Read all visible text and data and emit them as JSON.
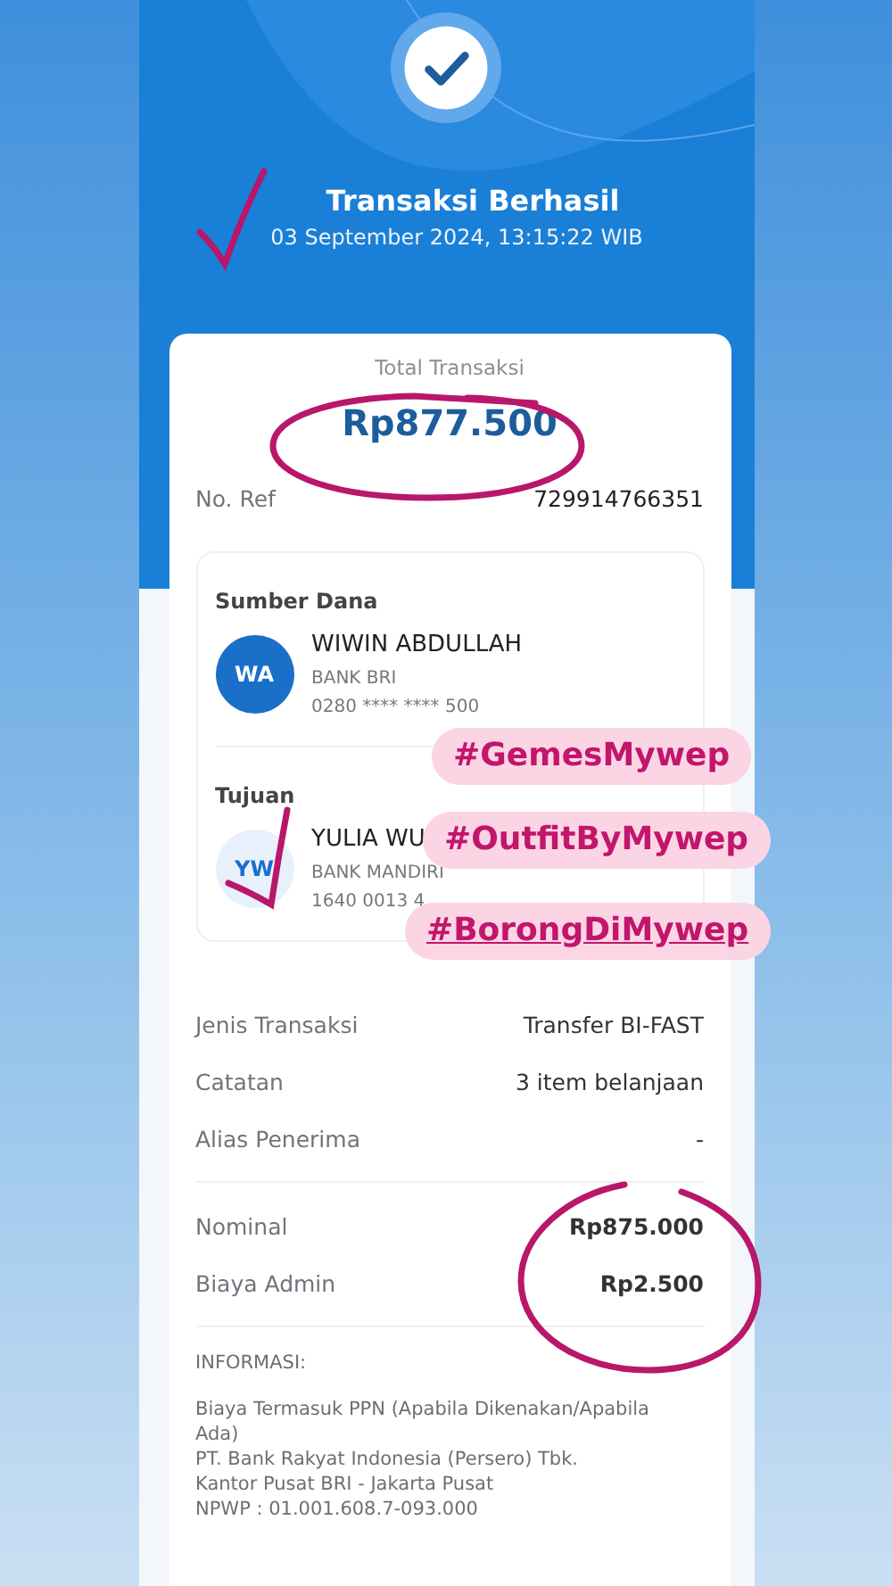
{
  "header": {
    "title": "Transaksi Berhasil",
    "datetime": "03 September 2024, 13:15:22 WIB"
  },
  "summary": {
    "total_label": "Total Transaksi",
    "total_amount": "Rp877.500",
    "ref_label": "No. Ref",
    "ref_value": "729914766351"
  },
  "parties": [
    {
      "heading": "Sumber Dana",
      "initials": "WA",
      "name": "WIWIN ABDULLAH",
      "bank": "BANK BRI",
      "account": "0280 **** **** 500",
      "color": "#1a6fc9"
    },
    {
      "heading": "Tujuan",
      "initials": "YW",
      "name": "YULIA WU",
      "bank": "BANK MANDIRI",
      "account": "1640 0013 4",
      "color": "#e8f1fb"
    }
  ],
  "details": [
    {
      "label": "Jenis Transaksi",
      "value": "Transfer BI-FAST"
    },
    {
      "label": "Catatan",
      "value": "3 item belanjaan"
    },
    {
      "label": "Alias Penerima",
      "value": "-"
    }
  ],
  "amounts": [
    {
      "label": "Nominal",
      "value": "Rp875.000"
    },
    {
      "label": "Biaya Admin",
      "value": "Rp2.500"
    }
  ],
  "info": {
    "heading": "INFORMASI:",
    "text": "Biaya Termasuk PPN (Apabila Dikenakan/Apabila Ada)\nPT. Bank Rakyat Indonesia (Persero) Tbk.\nKantor Pusat BRI - Jakarta Pusat\nNPWP : 01.001.608.7-093.000"
  },
  "stickers": [
    {
      "text": "#GemesMywep",
      "underlined": false
    },
    {
      "text": "#OutfitByMywep",
      "underlined": false
    },
    {
      "text": "#BorongDiMywep",
      "underlined": true
    }
  ]
}
